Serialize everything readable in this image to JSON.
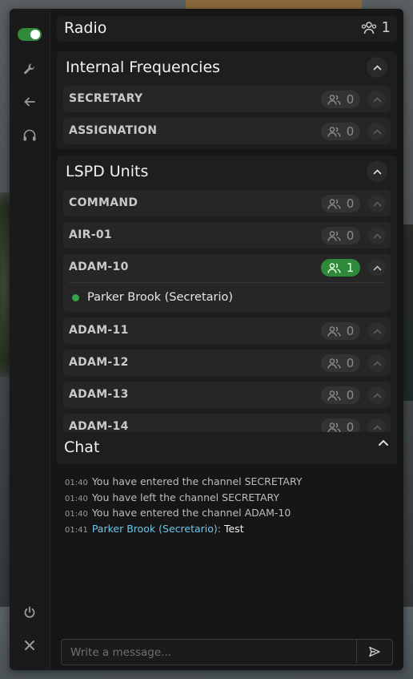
{
  "header": {
    "title": "Radio",
    "count": "1",
    "icon": "users-icon"
  },
  "sections": [
    {
      "title": "Internal Frequencies",
      "channels": [
        {
          "name": "SECRETARY",
          "count": "0"
        },
        {
          "name": "ASSIGNATION",
          "count": "0"
        }
      ]
    },
    {
      "title": "LSPD Units",
      "channels": [
        {
          "name": "COMMAND",
          "count": "0"
        },
        {
          "name": "AIR-01",
          "count": "0"
        },
        {
          "name": "ADAM-10",
          "count": "1",
          "members": [
            "Parker Brook (Secretario)"
          ]
        },
        {
          "name": "ADAM-11",
          "count": "0"
        },
        {
          "name": "ADAM-12",
          "count": "0"
        },
        {
          "name": "ADAM-13",
          "count": "0"
        },
        {
          "name": "ADAM-14",
          "count": "0"
        }
      ]
    }
  ],
  "chat": {
    "title": "Chat",
    "messages": [
      {
        "time": "01:40",
        "text": "You have entered the channel SECRETARY"
      },
      {
        "time": "01:40",
        "text": "You have left the channel SECRETARY"
      },
      {
        "time": "01:40",
        "text": "You have entered the channel ADAM-10"
      },
      {
        "time": "01:41",
        "author": "Parker Brook (Secretario):",
        "text": "Test"
      }
    ],
    "placeholder": "Write a message..."
  },
  "colors": {
    "accent_green": "#2e8a3a",
    "author_blue": "#6fc6e8"
  }
}
